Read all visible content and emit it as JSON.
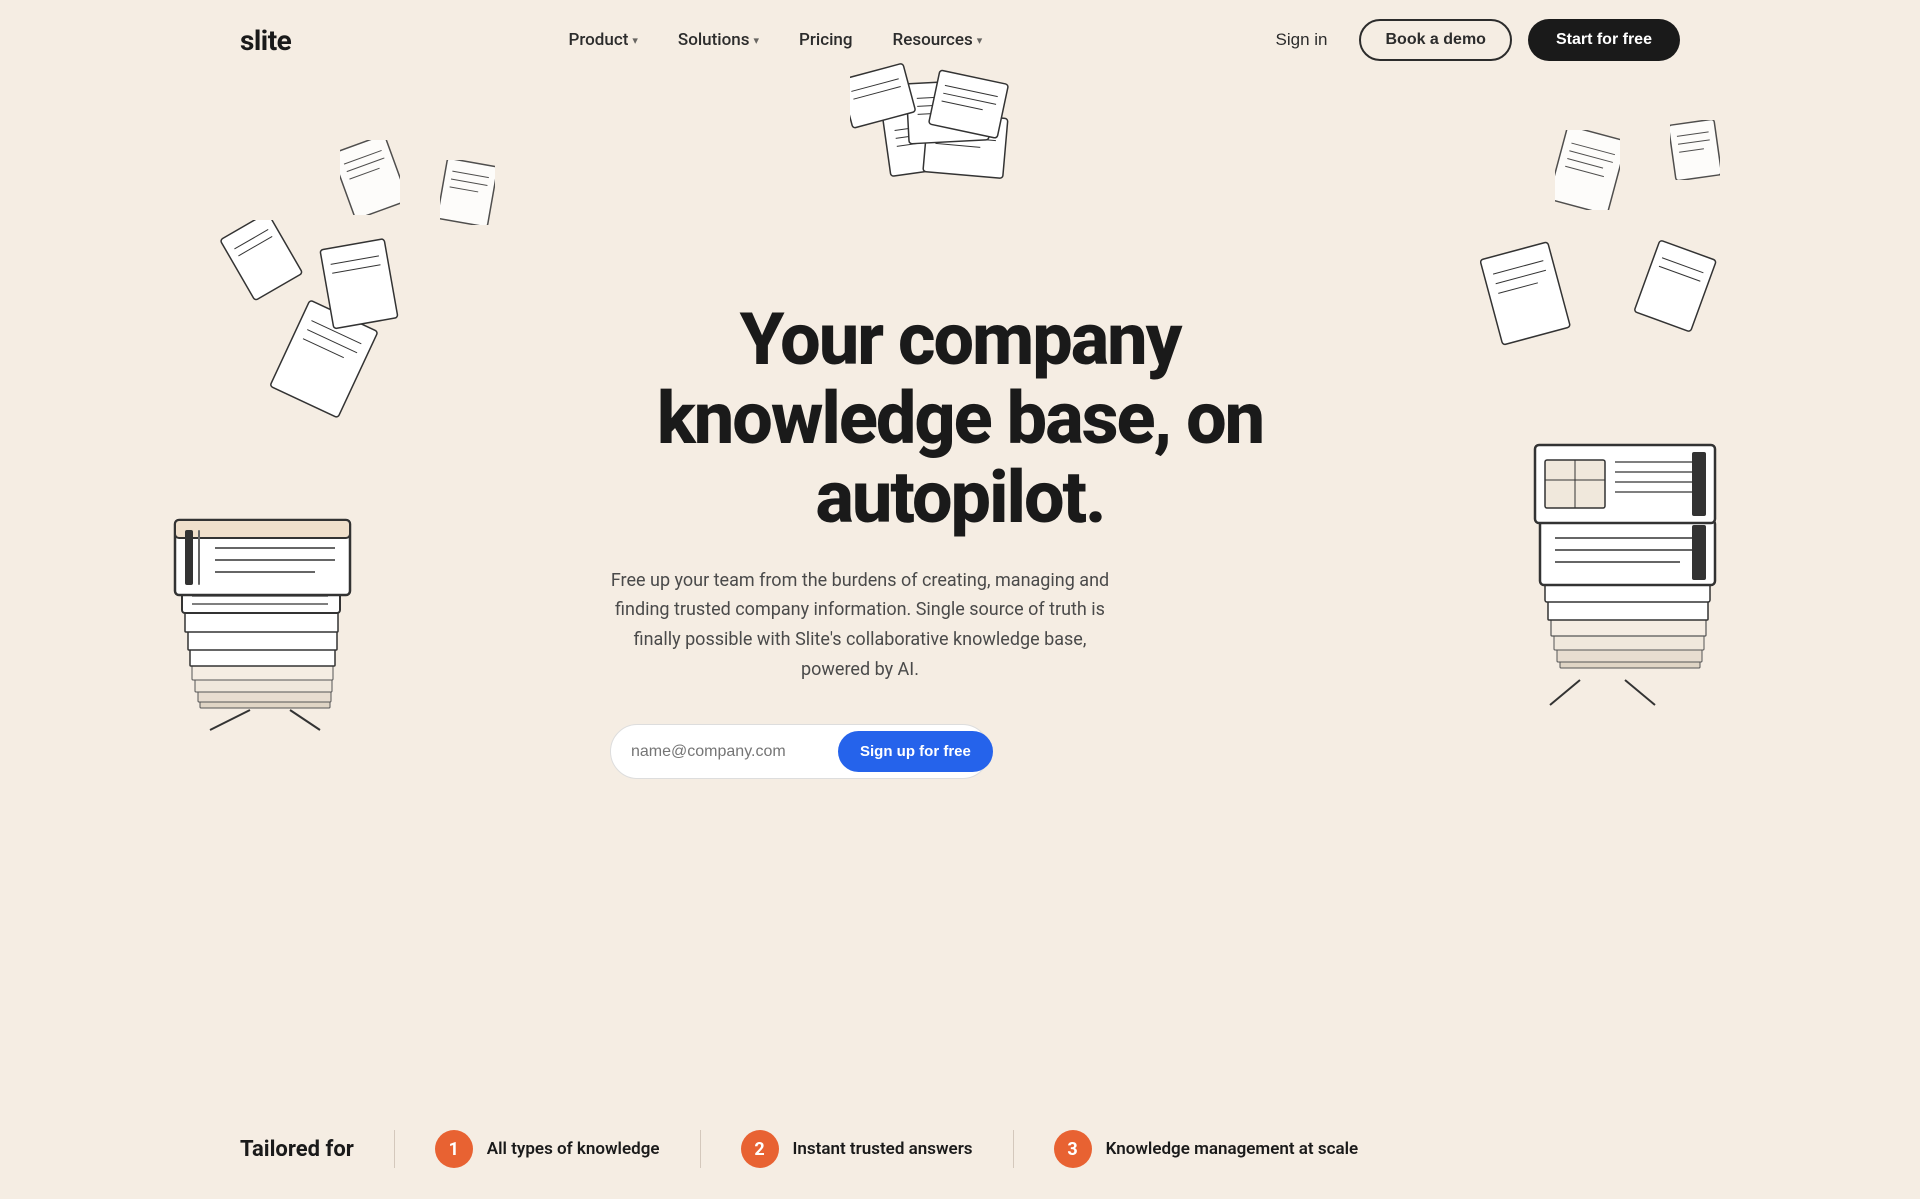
{
  "brand": {
    "logo": "slite"
  },
  "nav": {
    "links": [
      {
        "label": "Product",
        "hasDropdown": true
      },
      {
        "label": "Solutions",
        "hasDropdown": true
      },
      {
        "label": "Pricing",
        "hasDropdown": false
      },
      {
        "label": "Resources",
        "hasDropdown": true
      },
      {
        "label": "Sign in",
        "hasDropdown": false
      }
    ],
    "cta_demo": "Book a demo",
    "cta_start": "Start for free"
  },
  "hero": {
    "title": "Your company knowledge base, on autopilot.",
    "subtitle": "Free up your team from the burdens of creating, managing and finding trusted company information. Single source of truth is finally possible with Slite's collaborative knowledge base, powered by AI.",
    "email_placeholder": "name@company.com",
    "cta_signup": "Sign up for free"
  },
  "bottom_strip": {
    "tailored_label": "Tailored for",
    "features": [
      {
        "number": "1",
        "text": "All types of knowledge"
      },
      {
        "number": "2",
        "text": "Instant trusted answers"
      },
      {
        "number": "3",
        "text": "Knowledge management at scale"
      }
    ]
  }
}
